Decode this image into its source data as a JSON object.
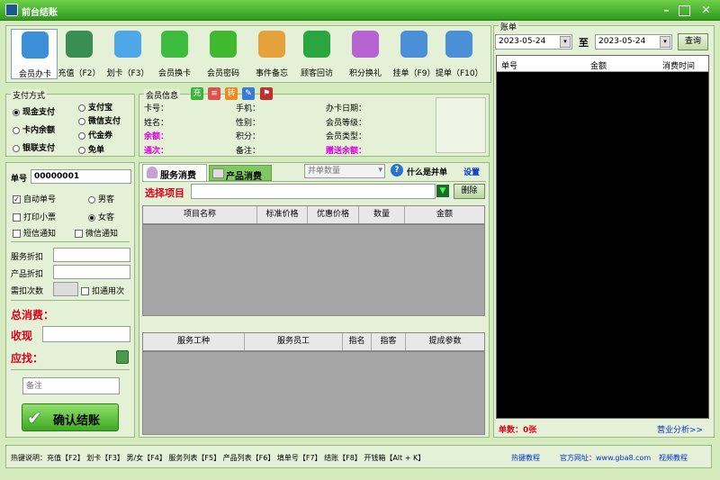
{
  "window": {
    "title": "前台结账"
  },
  "toolbar": [
    {
      "label": "会员办卡",
      "icon": "member-card-icon",
      "color": "#3b8fd8"
    },
    {
      "label": "充值（F2）",
      "icon": "money-bag-icon",
      "color": "#3a8d54"
    },
    {
      "label": "划卡（F3）",
      "icon": "swipe-card-icon",
      "color": "#4ea7e6"
    },
    {
      "label": "会员换卡",
      "icon": "refresh-icon",
      "color": "#3dbb3d"
    },
    {
      "label": "会员密码",
      "icon": "star-icon",
      "color": "#40b830"
    },
    {
      "label": "事件备忘",
      "icon": "memo-icon",
      "color": "#e6a23a"
    },
    {
      "label": "顾客回访",
      "icon": "phone-icon",
      "color": "#2aa63f"
    },
    {
      "label": "积分换礼",
      "icon": "gift-icon",
      "color": "#b564d2"
    },
    {
      "label": "挂单（F9）",
      "icon": "hang-order-icon",
      "color": "#4b8fd6"
    },
    {
      "label": "提单（F10）",
      "icon": "fetch-order-icon",
      "color": "#4b8fd6"
    }
  ],
  "payment": {
    "title": "支付方式",
    "options": [
      "现金支付",
      "支付宝",
      "卡内余额",
      "微信支付",
      "银联支付",
      "代金券",
      "免单"
    ],
    "selected": "现金支付"
  },
  "member": {
    "title": "会员信息",
    "quick_buttons": [
      "充",
      "≡",
      "转",
      "✎",
      "⚑"
    ],
    "fields": {
      "card_no": "卡号：",
      "phone": "手机：",
      "issue_date": "办卡日期：",
      "name": "姓名：",
      "gender": "性别：",
      "level": "会员等级：",
      "balance": "余额：",
      "points": "积分：",
      "type": "会员类型：",
      "pass_count": "通次：",
      "remark": "备注：",
      "gift_balance": "赠送余额："
    }
  },
  "order": {
    "order_no_label": "单号",
    "order_no": "00000001",
    "auto_no": "自动单号",
    "male": "男客",
    "print": "打印小票",
    "female": "女客",
    "sms": "短信通知",
    "wechat": "微信通知",
    "service_discount": "服务折扣",
    "product_discount": "产品折扣",
    "deduct_times": "需扣次数",
    "deduct_all": "扣通用次",
    "total_label": "总消费：",
    "collect_label": "收现",
    "change_label": "应找：",
    "remark_placeholder": "备注",
    "confirm": "确认结账"
  },
  "consume": {
    "tabs": [
      "服务消费",
      "产品消费"
    ],
    "merge_select": "并单数量",
    "what_is_merge": "什么是并单",
    "settings": "设置",
    "select_label": "选择项目",
    "delete": "删除",
    "item_columns": [
      "项目名称",
      "标准价格",
      "优惠价格",
      "数量",
      "金额"
    ],
    "staff_columns": [
      "服务工种",
      "服务员工",
      "指名",
      "指客",
      "提成参数"
    ]
  },
  "ledger": {
    "title": "账单",
    "date_from": "2023-05-24",
    "to": "至",
    "date_to": "2023-05-24",
    "query": "查询",
    "columns": [
      "单号",
      "金额",
      "消费时间"
    ],
    "count_label": "单数：0张",
    "analysis": "营业分析>>"
  },
  "statusbar": {
    "hotkeys": "热键说明：充值【F2】   划卡【F3】   男/女【F4】 服务列表【F5】 产品列表【F6】 填单号【F7】 结账【F8】 开钱箱【Alt + K】",
    "links": [
      "热键教程",
      "官方网址：www.gba8.com",
      "视频教程"
    ]
  }
}
